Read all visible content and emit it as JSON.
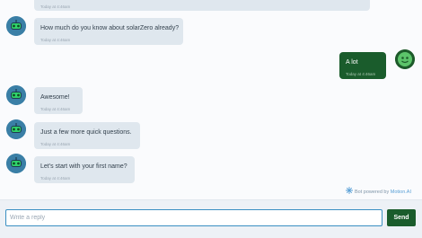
{
  "messages": [
    {
      "sender": "bot",
      "text": "",
      "time": "Today at 4:46am"
    },
    {
      "sender": "bot",
      "text": "How much do you know about solarZero already?",
      "time": "Today at 4:46am"
    },
    {
      "sender": "user",
      "text": "A lot",
      "time": "Today at 4:46am"
    },
    {
      "sender": "bot",
      "text": "Awesome!",
      "time": "Today at 4:46am"
    },
    {
      "sender": "bot",
      "text": "Just a few more quick questions.",
      "time": "Today at 4:46am"
    },
    {
      "sender": "bot",
      "text": "Let's start with your first name?",
      "time": "Today at 4:46am"
    }
  ],
  "footer": {
    "powered_prefix": "Bot powered by ",
    "powered_brand": "Motion.AI"
  },
  "composer": {
    "placeholder": "Write a reply",
    "value": "",
    "send_label": "Send"
  },
  "colors": {
    "bot_bubble": "#dfe7ee",
    "user_bubble": "#1a5c2c",
    "send_button": "#1a5c2c",
    "bot_avatar": "#3a7fa6"
  },
  "icons": {
    "bot_avatar": "robot-icon",
    "user_avatar": "user-avatar-icon",
    "brand_logo": "motion-ai-logo-icon"
  }
}
